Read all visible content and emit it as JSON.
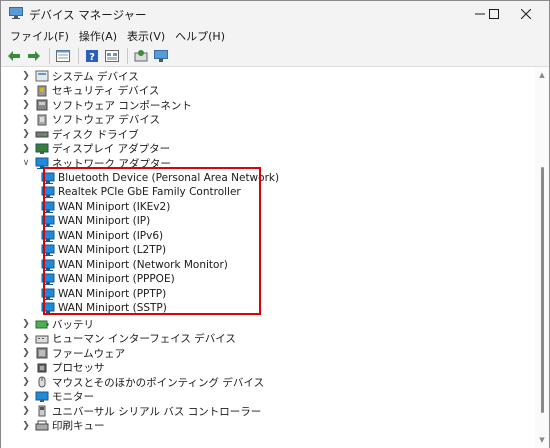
{
  "window": {
    "title": "デバイス マネージャー",
    "controls": {
      "minimize_icon": "minimize-icon",
      "maximize_icon": "maximize-icon",
      "close_icon": "close-icon"
    }
  },
  "menu": {
    "items": [
      {
        "label": "ファイル(F)"
      },
      {
        "label": "操作(A)"
      },
      {
        "label": "表示(V)"
      },
      {
        "label": "ヘルプ(H)"
      }
    ]
  },
  "toolbar": {
    "buttons": [
      "back-icon",
      "forward-icon",
      "properties-icon",
      "help-icon",
      "view-icon",
      "scan-hardware-icon",
      "monitor-icon"
    ]
  },
  "tree": {
    "categories_before": [
      {
        "label": "システム デバイス",
        "icon": "system-device-icon",
        "expanded": false
      },
      {
        "label": "セキュリティ デバイス",
        "icon": "security-device-icon",
        "expanded": false
      },
      {
        "label": "ソフトウェア コンポーネント",
        "icon": "software-component-icon",
        "expanded": false
      },
      {
        "label": "ソフトウェア デバイス",
        "icon": "software-device-icon",
        "expanded": false
      },
      {
        "label": "ディスク ドライブ",
        "icon": "disk-drive-icon",
        "expanded": false
      },
      {
        "label": "ディスプレイ アダプター",
        "icon": "display-adapter-icon",
        "expanded": false
      }
    ],
    "network_category": {
      "label": "ネットワーク アダプター",
      "icon": "network-adapter-icon",
      "expanded": true
    },
    "network_devices": [
      {
        "label": "Bluetooth Device (Personal Area Network)"
      },
      {
        "label": "Realtek PCIe GbE Family Controller"
      },
      {
        "label": "WAN Miniport (IKEv2)"
      },
      {
        "label": "WAN Miniport (IP)"
      },
      {
        "label": "WAN Miniport (IPv6)"
      },
      {
        "label": "WAN Miniport (L2TP)"
      },
      {
        "label": "WAN Miniport (Network Monitor)"
      },
      {
        "label": "WAN Miniport (PPPOE)"
      },
      {
        "label": "WAN Miniport (PPTP)"
      },
      {
        "label": "WAN Miniport (SSTP)"
      }
    ],
    "categories_after": [
      {
        "label": "バッテリ",
        "icon": "battery-icon",
        "expanded": false
      },
      {
        "label": "ヒューマン インターフェイス デバイス",
        "icon": "human-interface-device-icon",
        "expanded": false
      },
      {
        "label": "ファームウェア",
        "icon": "firmware-icon",
        "expanded": false
      },
      {
        "label": "プロセッサ",
        "icon": "processor-icon",
        "expanded": false
      },
      {
        "label": "マウスとそのほかのポインティング デバイス",
        "icon": "mouse-icon",
        "expanded": false
      },
      {
        "label": "モニター",
        "icon": "monitor-icon",
        "expanded": false
      },
      {
        "label": "ユニバーサル シリアル バス コントローラー",
        "icon": "usb-controller-icon",
        "expanded": false
      },
      {
        "label": "印刷キュー",
        "icon": "print-queue-icon",
        "expanded": false
      }
    ]
  },
  "colors": {
    "highlight_border": "#e0000b",
    "network_icon": "#1f8ad8",
    "window_chrome": "#f3f3f3"
  }
}
